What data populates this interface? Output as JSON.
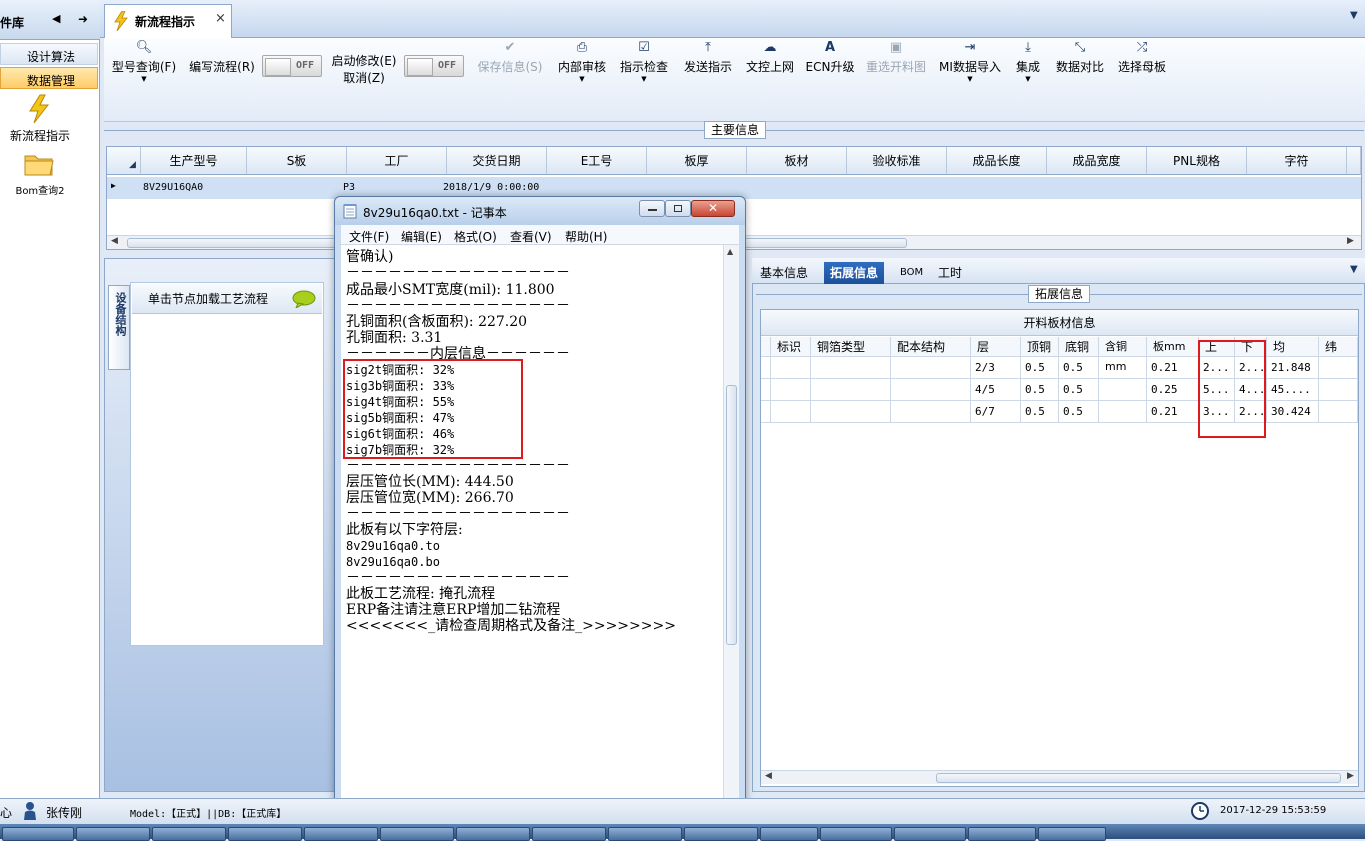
{
  "sidebar": {
    "title": "件库",
    "nav": [
      "设计算法",
      "数据管理"
    ],
    "icon_items": [
      {
        "label": "新流程指示",
        "icon": "lightning-icon"
      },
      {
        "label": "Bom查询2",
        "icon": "folder-icon"
      }
    ]
  },
  "tab": {
    "title": "新流程指示",
    "close": "×"
  },
  "toolbar": {
    "items": [
      {
        "label": "型号查询(F)",
        "icon": "search-icon",
        "disabled": false
      },
      {
        "label": "编写流程(R)",
        "icon": "",
        "disabled": false
      },
      {
        "label": "启动修改(E)",
        "label2": "取消(Z)",
        "icon": "",
        "disabled": false
      },
      {
        "label": "保存信息(S)",
        "icon": "check-icon",
        "disabled": true
      },
      {
        "label": "内部审核",
        "icon": "printer-icon",
        "disabled": false
      },
      {
        "label": "指示检查",
        "icon": "checkbox-icon",
        "disabled": false
      },
      {
        "label": "发送指示",
        "icon": "upload-icon",
        "disabled": false
      },
      {
        "label": "文控上网",
        "icon": "cloud-upload-icon",
        "disabled": false
      },
      {
        "label": "ECN升级",
        "icon": "font-icon",
        "disabled": false
      },
      {
        "label": "重选开料图",
        "icon": "image-icon",
        "disabled": true
      },
      {
        "label": "MI数据导入",
        "icon": "sign-in-icon",
        "disabled": false
      },
      {
        "label": "集成",
        "icon": "download-icon",
        "disabled": false
      },
      {
        "label": "数据对比",
        "icon": "compress-icon",
        "disabled": false
      },
      {
        "label": "选择母板",
        "icon": "shuffle-icon",
        "disabled": false
      }
    ],
    "toggle_off": "OFF"
  },
  "main_info": {
    "section_title": "主要信息",
    "columns": [
      "生产型号",
      "S板",
      "工厂",
      "交货日期",
      "E工号",
      "板厚",
      "板材",
      "验收标准",
      "成品长度",
      "成品宽度",
      "PNL规格",
      "字符"
    ],
    "rows": [
      [
        "8V29U16QA0",
        "",
        "P3",
        "2018/1/9 0:00:00",
        "",
        "",
        "",
        "",
        "",
        "",
        "",
        ""
      ]
    ]
  },
  "left_panel": {
    "vertical_tab": "设备结构",
    "node_hint": "单击节点加载工艺流程"
  },
  "notepad": {
    "title": "8v29u16qa0.txt - 记事本",
    "menu": [
      "文件(F)",
      "编辑(E)",
      "格式(O)",
      "查看(V)",
      "帮助(H)"
    ],
    "lines": [
      "管确认)",
      "－－－－－－－－－－－－－－－－",
      "成品最小SMT宽度(mil): 11.800",
      "－－－－－－－－－－－－－－－－",
      "孔铜面积(含板面积): 227.20",
      "孔铜面积: 3.31",
      "－－－－－－内层信息－－－－－－",
      "sig2t铜面积: 32%",
      "sig3b铜面积: 33%",
      "sig4t铜面积: 55%",
      "sig5b铜面积: 47%",
      "sig6t铜面积: 46%",
      "sig7b铜面积: 32%",
      "－－－－－－－－－－－－－－－－",
      "层压管位长(MM): 444.50",
      "层压管位宽(MM): 266.70",
      "－－－－－－－－－－－－－－－－",
      "此板有以下字符层:",
      "8v29u16qa0.to",
      "8v29u16qa0.bo",
      "－－－－－－－－－－－－－－－－",
      "此板工艺流程: 掩孔流程",
      "ERP备注请注意ERP增加二钻流程",
      "<<<<<<<_请检查周期格式及备注_>>>>>>>>"
    ]
  },
  "right_panel": {
    "tabs": [
      "基本信息",
      "拓展信息",
      "BOM",
      "工时"
    ],
    "active_tab": "拓展信息",
    "section_title": "拓展信息",
    "table_title": "开料板材信息",
    "columns": [
      "标识",
      "铜箔类型",
      "配本结构",
      "层",
      "顶铜",
      "底铜",
      "含铜mm",
      "板mm",
      "上",
      "下",
      "均",
      "纬"
    ],
    "rows": [
      [
        "",
        "",
        "",
        "2/3",
        "0.5",
        "0.5",
        "",
        "0.21",
        "2...",
        "2...",
        "21.848",
        ""
      ],
      [
        "",
        "",
        "",
        "4/5",
        "0.5",
        "0.5",
        "",
        "0.25",
        "5...",
        "4...",
        "45....",
        ""
      ],
      [
        "",
        "",
        "",
        "6/7",
        "0.5",
        "0.5",
        "",
        "0.21",
        "3...",
        "2...",
        "30.424",
        ""
      ]
    ]
  },
  "status": {
    "left": "心",
    "user": "张传刚",
    "model": "Model:【正式】||DB:【正式库】",
    "datetime": "2017-12-29 15:53:59"
  },
  "colors": {
    "highlight_box": "#e0191c",
    "selected_row": "#cfe0f5",
    "active_tab": "#1b4f9a"
  }
}
